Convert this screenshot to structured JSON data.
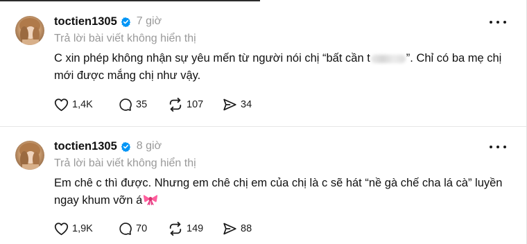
{
  "posts": [
    {
      "username": "toctien1305",
      "time": "7 giờ",
      "reply_context": "Trả lời bài viết không hiển thị",
      "text_before_blur": "C xin phép không nhận sự yêu mến từ người nói chị “bất cần t",
      "text_after_blur": "”. Chỉ có ba mẹ chị mới được mắng chị như vậy.",
      "likes": "1,4K",
      "comments": "35",
      "reposts": "107",
      "shares": "34"
    },
    {
      "username": "toctien1305",
      "time": "8 giờ",
      "reply_context": "Trả lời bài viết không hiển thị",
      "text": "Em chê c thì được. Nhưng em chê chị em của chị là c sẽ hát “nề gà chế cha lá cà” luyền ngay khum vỡn á",
      "emoji": "ribbon-bow",
      "likes": "1,9K",
      "comments": "70",
      "reposts": "149",
      "shares": "88"
    }
  ],
  "icons": {
    "verified": "verified-badge-icon",
    "more": "more-options-icon",
    "like": "heart-icon",
    "comment": "comment-bubble-icon",
    "repost": "repost-icon",
    "share": "share-send-icon"
  },
  "colors": {
    "text": "#101010",
    "muted": "#999999",
    "verified": "#0095f6",
    "divider": "#e6e6e6"
  }
}
